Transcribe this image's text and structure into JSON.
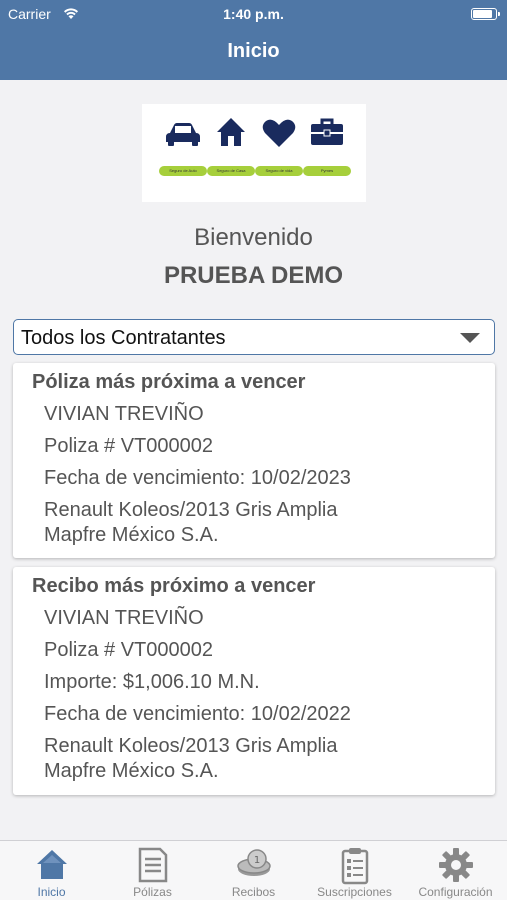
{
  "status_bar": {
    "carrier": "Carrier",
    "time": "1:40 p.m."
  },
  "nav": {
    "title": "Inicio"
  },
  "logo": {
    "tags": [
      "Seguro de Auto",
      "Seguro de Casa",
      "Seguro de vida",
      "Pymes"
    ],
    "icons": [
      "car-icon",
      "house-icon",
      "heart-icon",
      "briefcase-icon"
    ],
    "icon_color": "#1a2b5e",
    "tag_color": "#a6cf3b"
  },
  "welcome": {
    "greeting": "Bienvenido",
    "user": "PRUEBA DEMO"
  },
  "contratantes_select": {
    "value": "Todos los Contratantes"
  },
  "poliza_card": {
    "title": "Póliza más próxima a vencer",
    "name": "VIVIAN TREVIÑO",
    "policy": "Poliza # VT000002",
    "expiry": "Fecha de vencimiento: 10/02/2023",
    "vehicle": "Renault Koleos/2013 Gris Amplia",
    "insurer": "Mapfre México S.A."
  },
  "recibo_card": {
    "title": "Recibo más próximo a vencer",
    "name": "VIVIAN TREVIÑO",
    "policy": "Poliza # VT000002",
    "amount": "Importe: $1,006.10 M.N.",
    "expiry": "Fecha de vencimiento: 10/02/2022",
    "vehicle": "Renault Koleos/2013 Gris Amplia",
    "insurer": "Mapfre México S.A."
  },
  "tabs": [
    {
      "label": "Inicio",
      "icon": "home-icon",
      "active": true
    },
    {
      "label": "Pólizas",
      "icon": "document-icon",
      "active": false
    },
    {
      "label": "Recibos",
      "icon": "coins-icon",
      "active": false
    },
    {
      "label": "Suscripciones",
      "icon": "clipboard-icon",
      "active": false
    },
    {
      "label": "Configuración",
      "icon": "gear-icon",
      "active": false
    }
  ],
  "colors": {
    "primary": "#4f77a6",
    "inactive_tab": "#888888",
    "text": "#555555"
  }
}
